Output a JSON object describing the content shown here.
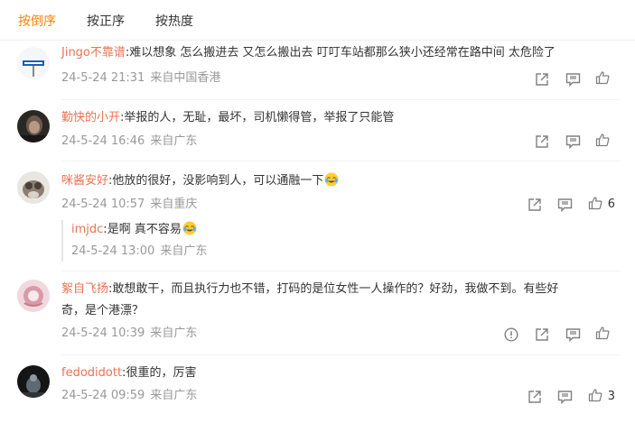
{
  "tabs": [
    {
      "label": "按倒序",
      "active": true
    },
    {
      "label": "按正序",
      "active": false
    },
    {
      "label": "按热度",
      "active": false
    }
  ],
  "colors": {
    "accent": "#ff8200",
    "username": "#eb7350",
    "meta": "#999999"
  },
  "comments": [
    {
      "username": "Jingo不靠谱",
      "text": "难以想象 怎么搬进去 又怎么搬出去 叮叮车站都那么狭小还经常在路中间 太危险了",
      "time": "24-5-24 21:31",
      "source": "来自中国香港",
      "likes": ""
    },
    {
      "username": "勤快的小开",
      "text": "举报的人，无耻，最坏，司机懒得管，举报了只能管",
      "time": "24-5-24 16:46",
      "source": "来自广东",
      "likes": ""
    },
    {
      "username": "咪酱安好",
      "text": "他放的很好，没影响到人，可以通融一下",
      "emoji": "laugh-cry-emoji",
      "time": "24-5-24 10:57",
      "source": "来自重庆",
      "likes": "6",
      "reply": {
        "username": "imjdc",
        "text": "是啊 真不容易",
        "emoji": "laugh-cry-emoji",
        "time": "24-5-24 13:00",
        "source": "来自广东"
      }
    },
    {
      "username": "絮自飞扬",
      "text_line1": "敢想敢干，而且执行力也不错，打码的是位女性一人操作的？好劲，我做不到。有些好",
      "text_line2": "奇，是个港漂？",
      "time": "24-5-24 10:39",
      "source": "来自广东",
      "likes": ""
    },
    {
      "username": "fedodidott",
      "text": "很重的，厉害",
      "time": "24-5-24 09:59",
      "source": "来自广东",
      "likes": "3"
    }
  ]
}
